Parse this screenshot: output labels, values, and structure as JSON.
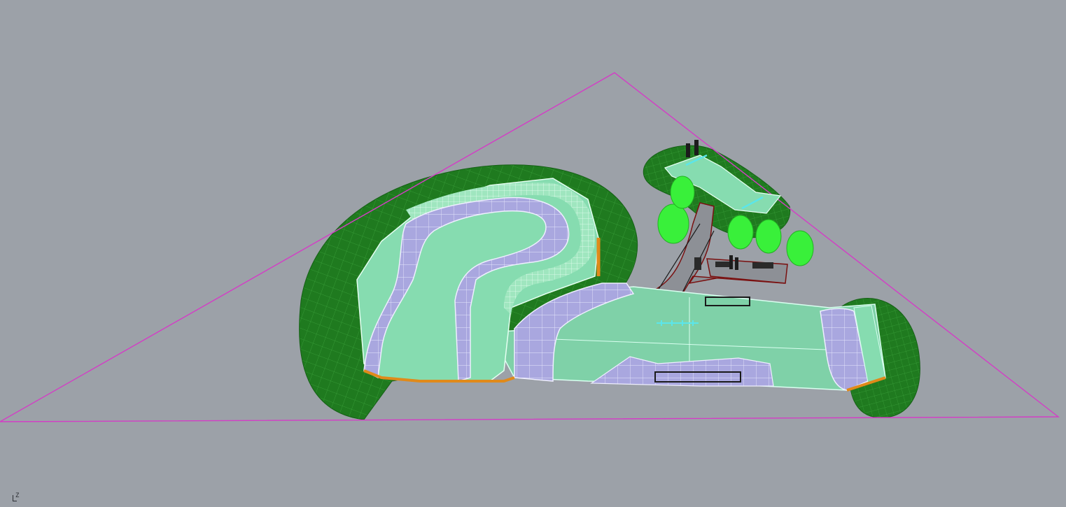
{
  "viewport": {
    "background": "#9ca1a8",
    "axis_label": "Z"
  },
  "colors": {
    "boundary": "#d43cc6",
    "mound_dark": "#1f7a1f",
    "mound_mesh": "#2e9a2e",
    "deck": "#86dcb0",
    "deck_edge": "#d9fff0",
    "bowl": "#a9a7df",
    "bowl_edge": "#eeeefe",
    "coping": "#e08a1a",
    "tree": "#39f03a",
    "path": "#8d9096",
    "path_edge": "#7a1010",
    "rail": "#5be6ea"
  },
  "objects": [
    {
      "name": "site-boundary",
      "type": "polyline"
    },
    {
      "name": "left-landscape-mound",
      "type": "surface"
    },
    {
      "name": "right-landscape-mound",
      "type": "surface"
    },
    {
      "name": "top-landscape-mound",
      "type": "surface"
    },
    {
      "name": "snake-bowl",
      "type": "surface"
    },
    {
      "name": "street-plaza",
      "type": "surface"
    },
    {
      "name": "entry-path",
      "type": "surface"
    },
    {
      "name": "trees",
      "type": "group"
    },
    {
      "name": "benches",
      "type": "group"
    }
  ]
}
